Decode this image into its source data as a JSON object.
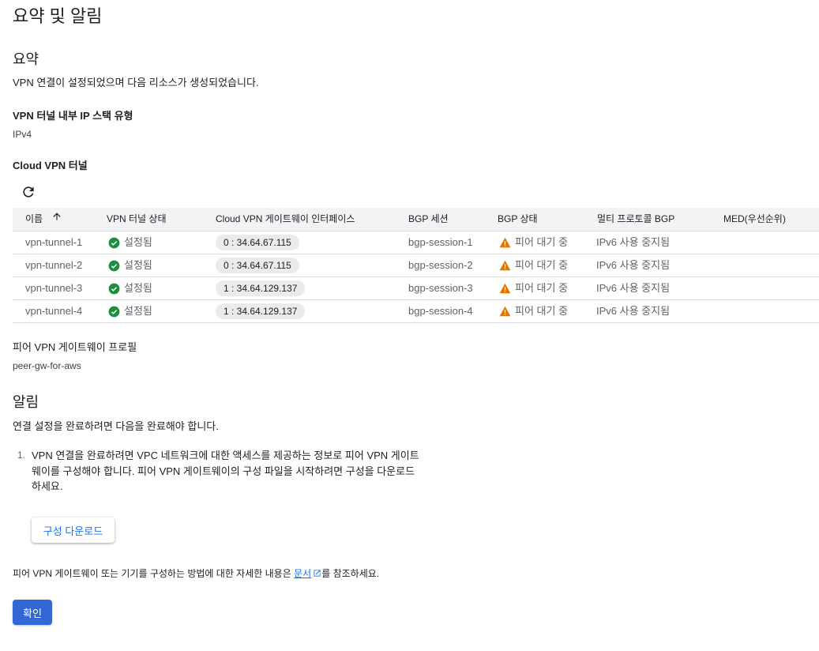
{
  "page": {
    "title": "요약 및 알림"
  },
  "summary": {
    "heading": "요약",
    "description": "VPN 연결이 설정되었으며 다음 리소스가 생성되었습니다.",
    "ip_stack": {
      "label": "VPN 터널 내부 IP 스택 유형",
      "value": "IPv4"
    },
    "tunnels_label": "Cloud VPN 터널",
    "refresh_icon": "refresh-icon"
  },
  "table": {
    "columns": [
      "이름",
      "VPN 터널 상태",
      "Cloud VPN 게이트웨이 인터페이스",
      "BGP 세션",
      "BGP 상태",
      "멀티 프로토콜 BGP",
      "MED(우선순위)"
    ],
    "sort_icon": "arrow-up-icon",
    "rows": [
      {
        "name": "vpn-tunnel-1",
        "status": "설정됨",
        "interface": "0 : 34.64.67.115",
        "bgp_session": "bgp-session-1",
        "bgp_status": "피어 대기 중",
        "multiprotocol": "IPv6 사용 중지됨",
        "med": ""
      },
      {
        "name": "vpn-tunnel-2",
        "status": "설정됨",
        "interface": "0 : 34.64.67.115",
        "bgp_session": "bgp-session-2",
        "bgp_status": "피어 대기 중",
        "multiprotocol": "IPv6 사용 중지됨",
        "med": ""
      },
      {
        "name": "vpn-tunnel-3",
        "status": "설정됨",
        "interface": "1 : 34.64.129.137",
        "bgp_session": "bgp-session-3",
        "bgp_status": "피어 대기 중",
        "multiprotocol": "IPv6 사용 중지됨",
        "med": ""
      },
      {
        "name": "vpn-tunnel-4",
        "status": "설정됨",
        "interface": "1 : 34.64.129.137",
        "bgp_session": "bgp-session-4",
        "bgp_status": "피어 대기 중",
        "multiprotocol": "IPv6 사용 중지됨",
        "med": ""
      }
    ]
  },
  "peer_gateway": {
    "label": "피어 VPN 게이트웨이 프로필",
    "value": "peer-gw-for-aws"
  },
  "alerts": {
    "heading": "알림",
    "description": "연결 설정을 완료하려면 다음을 완료해야 합니다.",
    "items": [
      {
        "number": "1.",
        "text": "VPN 연결을 완료하려면 VPC 네트워크에 대한 액세스를 제공하는 정보로 피어 VPN 게이트웨이를 구성해야 합니다. 피어 VPN 게이트웨이의 구성 파일을 시작하려면 구성을 다운로드하세요."
      }
    ],
    "download_button": "구성 다운로드"
  },
  "footer": {
    "text_before": "피어 VPN 게이트웨이 또는 기기를 구성하는 방법에 대한 자세한 내용은 ",
    "link_text": "문서",
    "text_after": "를 참조하세요.",
    "confirm_button": "확인"
  },
  "colors": {
    "success": "#1e8e3e",
    "warning": "#e37400",
    "primary": "#3367d6",
    "link": "#1a73e8"
  }
}
